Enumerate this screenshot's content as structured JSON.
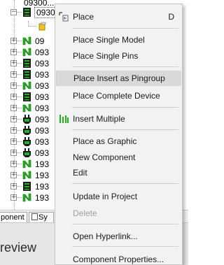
{
  "tree": {
    "top_label": "09300...",
    "rows": [
      {
        "label": "0930",
        "icon": "green-chip-icon",
        "selected": true
      },
      {
        "label": "",
        "icon": "sub-component-icon",
        "selected": false
      },
      {
        "label": "09",
        "icon": "green-n-icon",
        "selected": false
      },
      {
        "label": "093",
        "icon": "green-n-icon",
        "selected": false
      },
      {
        "label": "093",
        "icon": "green-chip-icon",
        "selected": false
      },
      {
        "label": "093",
        "icon": "green-chip-icon",
        "selected": false
      },
      {
        "label": "093",
        "icon": "green-n-icon",
        "selected": false
      },
      {
        "label": "093",
        "icon": "green-chip-icon",
        "selected": false
      },
      {
        "label": "093",
        "icon": "green-n-icon",
        "selected": false
      },
      {
        "label": "093",
        "icon": "green-plug-icon",
        "selected": false
      },
      {
        "label": "093",
        "icon": "green-plug-icon",
        "selected": false
      },
      {
        "label": "093",
        "icon": "green-plug-icon",
        "selected": false
      },
      {
        "label": "093",
        "icon": "green-plug-icon",
        "selected": false
      },
      {
        "label": "193",
        "icon": "green-n-icon",
        "selected": false
      },
      {
        "label": "193",
        "icon": "green-n-icon",
        "selected": false
      },
      {
        "label": "193",
        "icon": "green-chip-icon",
        "selected": false
      },
      {
        "label": "193",
        "icon": "green-n-icon",
        "selected": false
      }
    ]
  },
  "tabs": [
    {
      "label": "ponent"
    },
    {
      "label": "Sy"
    }
  ],
  "preview_title": "review",
  "menu": {
    "items": [
      {
        "label": "Place",
        "shortcut": "D",
        "icon": "place-cursor-icon",
        "disabled": false,
        "highlighted": false
      },
      {
        "label": "Place Single Model",
        "shortcut": "",
        "icon": "",
        "disabled": false,
        "highlighted": false
      },
      {
        "label": "Place Single Pins",
        "shortcut": "",
        "icon": "",
        "disabled": false,
        "highlighted": false
      },
      {
        "label": "Place Insert as Pingroup",
        "shortcut": "",
        "icon": "",
        "disabled": false,
        "highlighted": true
      },
      {
        "label": "Place Complete Device",
        "shortcut": "",
        "icon": "",
        "disabled": false,
        "highlighted": false
      },
      {
        "label": "Insert Multiple",
        "shortcut": "",
        "icon": "insert-multiple-icon",
        "disabled": false,
        "highlighted": false
      },
      {
        "label": "Place as Graphic",
        "shortcut": "",
        "icon": "",
        "disabled": false,
        "highlighted": false
      },
      {
        "label": "New Component",
        "shortcut": "",
        "icon": "",
        "disabled": false,
        "highlighted": false
      },
      {
        "label": "Edit",
        "shortcut": "",
        "icon": "",
        "disabled": false,
        "highlighted": false
      },
      {
        "label": "Update in Project",
        "shortcut": "",
        "icon": "",
        "disabled": false,
        "highlighted": false
      },
      {
        "label": "Delete",
        "shortcut": "",
        "icon": "",
        "disabled": true,
        "highlighted": false
      },
      {
        "label": "Open Hyperlink...",
        "shortcut": "",
        "icon": "",
        "disabled": false,
        "highlighted": false
      },
      {
        "label": "Component Properties...",
        "shortcut": "",
        "icon": "",
        "disabled": false,
        "highlighted": false
      }
    ]
  },
  "colors": {
    "icon_green": "#22b21f",
    "icon_dark": "#1c1c1c",
    "menu_bg": "#f2f2f2",
    "menu_highlight": "#d9d9d9",
    "disabled_text": "#a0a0a0"
  }
}
